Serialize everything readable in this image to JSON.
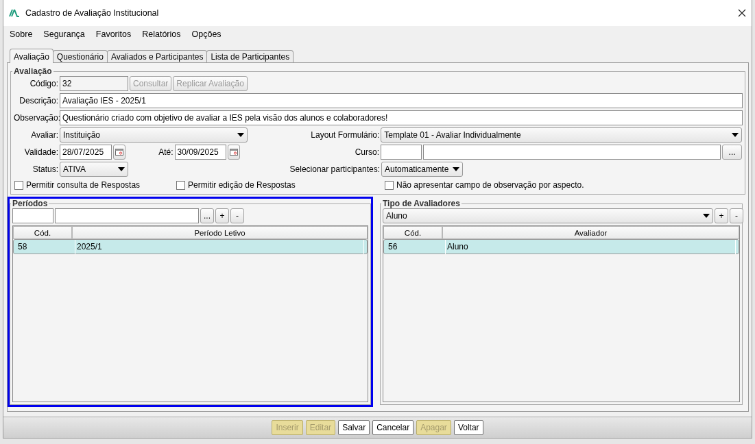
{
  "window": {
    "title": "Cadastro de Avaliação Institucional"
  },
  "menu": [
    "Sobre",
    "Segurança",
    "Favoritos",
    "Relatórios",
    "Opções"
  ],
  "tabs": [
    {
      "label": "Avaliação",
      "selected": true
    },
    {
      "label": "Questionário",
      "selected": false
    },
    {
      "label": "Avaliados e Participantes",
      "selected": false
    },
    {
      "label": "Lista de Participantes",
      "selected": false
    }
  ],
  "avaliacao": {
    "title": "Avaliação",
    "codigo": {
      "label": "Código:",
      "value": "32"
    },
    "actions": [
      {
        "label": "Consultar",
        "disabled": true
      },
      {
        "label": "Replicar Avaliação",
        "disabled": true
      }
    ],
    "descricao": {
      "label": "Descrição:",
      "value": "Avaliação IES - 2025/1"
    },
    "observacao": {
      "label": "Observação:",
      "value": "Questionário criado com objetivo de avaliar a IES pela visão dos alunos e colaboradores!"
    },
    "avaliar": {
      "label": "Avaliar:",
      "value": "Instituição"
    },
    "layout_formulario": {
      "label": "Layout Formulário:",
      "value": "Template 01 - Avaliar Individualmente"
    },
    "validade": {
      "label": "Validade:",
      "value": "28/07/2025"
    },
    "ate": {
      "label": "Até:",
      "value": "30/09/2025"
    },
    "curso": {
      "label": "Curso:",
      "button": "..."
    },
    "status": {
      "label": "Status:",
      "value": "ATIVA"
    },
    "selecionar_participantes": {
      "label": "Selecionar participantes:",
      "value": "Automaticamente"
    },
    "checkboxes": [
      {
        "label": "Permitir consulta de Respostas",
        "checked": false
      },
      {
        "label": "Permitir edição de Respostas",
        "checked": false
      },
      {
        "label": "Não apresentar campo de observação por aspecto.",
        "checked": false
      }
    ]
  },
  "periodos": {
    "title": "Períodos",
    "focused": true,
    "buttons": [
      "...",
      "+",
      "-"
    ],
    "columns": [
      "Cód.",
      "Período Letivo"
    ],
    "rows": [
      {
        "cells": [
          "58",
          "2025/1"
        ],
        "selected": true
      }
    ]
  },
  "tipo_avaliadores": {
    "title": "Tipo de Avaliadores",
    "focused": false,
    "select": "Aluno",
    "buttons": [
      "+",
      "-"
    ],
    "columns": [
      "Cód.",
      "Avaliador"
    ],
    "rows": [
      {
        "cells": [
          "56",
          "Aluno"
        ],
        "selected": true
      }
    ]
  },
  "buttons": [
    {
      "label": "Inserir",
      "disabled": true
    },
    {
      "label": "Editar",
      "disabled": true
    },
    {
      "label": "Salvar",
      "disabled": false
    },
    {
      "label": "Cancelar",
      "disabled": false
    },
    {
      "label": "Apagar",
      "disabled": true
    },
    {
      "label": "Voltar",
      "disabled": false
    }
  ]
}
